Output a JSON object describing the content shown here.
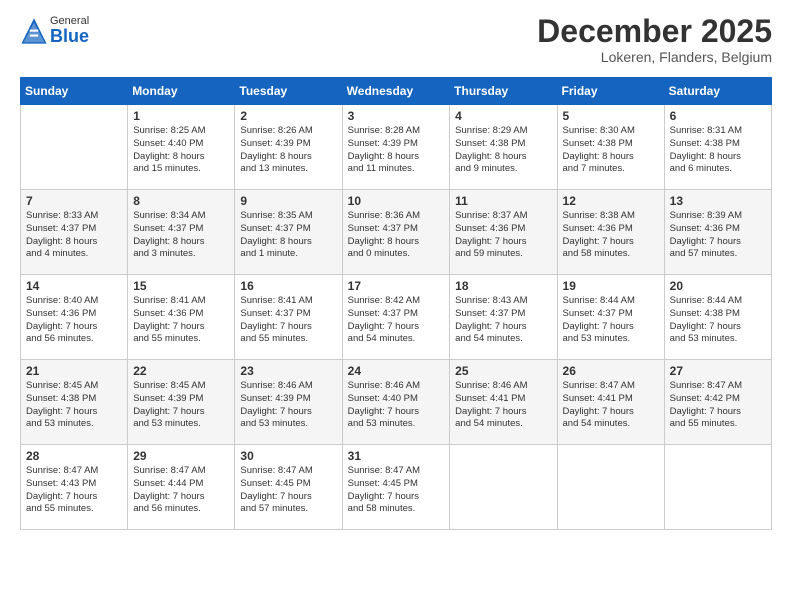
{
  "header": {
    "logo_general": "General",
    "logo_blue": "Blue",
    "month_title": "December 2025",
    "location": "Lokeren, Flanders, Belgium"
  },
  "days_of_week": [
    "Sunday",
    "Monday",
    "Tuesday",
    "Wednesday",
    "Thursday",
    "Friday",
    "Saturday"
  ],
  "weeks": [
    [
      {
        "day": "",
        "info": ""
      },
      {
        "day": "1",
        "info": "Sunrise: 8:25 AM\nSunset: 4:40 PM\nDaylight: 8 hours\nand 15 minutes."
      },
      {
        "day": "2",
        "info": "Sunrise: 8:26 AM\nSunset: 4:39 PM\nDaylight: 8 hours\nand 13 minutes."
      },
      {
        "day": "3",
        "info": "Sunrise: 8:28 AM\nSunset: 4:39 PM\nDaylight: 8 hours\nand 11 minutes."
      },
      {
        "day": "4",
        "info": "Sunrise: 8:29 AM\nSunset: 4:38 PM\nDaylight: 8 hours\nand 9 minutes."
      },
      {
        "day": "5",
        "info": "Sunrise: 8:30 AM\nSunset: 4:38 PM\nDaylight: 8 hours\nand 7 minutes."
      },
      {
        "day": "6",
        "info": "Sunrise: 8:31 AM\nSunset: 4:38 PM\nDaylight: 8 hours\nand 6 minutes."
      }
    ],
    [
      {
        "day": "7",
        "info": "Sunrise: 8:33 AM\nSunset: 4:37 PM\nDaylight: 8 hours\nand 4 minutes."
      },
      {
        "day": "8",
        "info": "Sunrise: 8:34 AM\nSunset: 4:37 PM\nDaylight: 8 hours\nand 3 minutes."
      },
      {
        "day": "9",
        "info": "Sunrise: 8:35 AM\nSunset: 4:37 PM\nDaylight: 8 hours\nand 1 minute."
      },
      {
        "day": "10",
        "info": "Sunrise: 8:36 AM\nSunset: 4:37 PM\nDaylight: 8 hours\nand 0 minutes."
      },
      {
        "day": "11",
        "info": "Sunrise: 8:37 AM\nSunset: 4:36 PM\nDaylight: 7 hours\nand 59 minutes."
      },
      {
        "day": "12",
        "info": "Sunrise: 8:38 AM\nSunset: 4:36 PM\nDaylight: 7 hours\nand 58 minutes."
      },
      {
        "day": "13",
        "info": "Sunrise: 8:39 AM\nSunset: 4:36 PM\nDaylight: 7 hours\nand 57 minutes."
      }
    ],
    [
      {
        "day": "14",
        "info": "Sunrise: 8:40 AM\nSunset: 4:36 PM\nDaylight: 7 hours\nand 56 minutes."
      },
      {
        "day": "15",
        "info": "Sunrise: 8:41 AM\nSunset: 4:36 PM\nDaylight: 7 hours\nand 55 minutes."
      },
      {
        "day": "16",
        "info": "Sunrise: 8:41 AM\nSunset: 4:37 PM\nDaylight: 7 hours\nand 55 minutes."
      },
      {
        "day": "17",
        "info": "Sunrise: 8:42 AM\nSunset: 4:37 PM\nDaylight: 7 hours\nand 54 minutes."
      },
      {
        "day": "18",
        "info": "Sunrise: 8:43 AM\nSunset: 4:37 PM\nDaylight: 7 hours\nand 54 minutes."
      },
      {
        "day": "19",
        "info": "Sunrise: 8:44 AM\nSunset: 4:37 PM\nDaylight: 7 hours\nand 53 minutes."
      },
      {
        "day": "20",
        "info": "Sunrise: 8:44 AM\nSunset: 4:38 PM\nDaylight: 7 hours\nand 53 minutes."
      }
    ],
    [
      {
        "day": "21",
        "info": "Sunrise: 8:45 AM\nSunset: 4:38 PM\nDaylight: 7 hours\nand 53 minutes."
      },
      {
        "day": "22",
        "info": "Sunrise: 8:45 AM\nSunset: 4:39 PM\nDaylight: 7 hours\nand 53 minutes."
      },
      {
        "day": "23",
        "info": "Sunrise: 8:46 AM\nSunset: 4:39 PM\nDaylight: 7 hours\nand 53 minutes."
      },
      {
        "day": "24",
        "info": "Sunrise: 8:46 AM\nSunset: 4:40 PM\nDaylight: 7 hours\nand 53 minutes."
      },
      {
        "day": "25",
        "info": "Sunrise: 8:46 AM\nSunset: 4:41 PM\nDaylight: 7 hours\nand 54 minutes."
      },
      {
        "day": "26",
        "info": "Sunrise: 8:47 AM\nSunset: 4:41 PM\nDaylight: 7 hours\nand 54 minutes."
      },
      {
        "day": "27",
        "info": "Sunrise: 8:47 AM\nSunset: 4:42 PM\nDaylight: 7 hours\nand 55 minutes."
      }
    ],
    [
      {
        "day": "28",
        "info": "Sunrise: 8:47 AM\nSunset: 4:43 PM\nDaylight: 7 hours\nand 55 minutes."
      },
      {
        "day": "29",
        "info": "Sunrise: 8:47 AM\nSunset: 4:44 PM\nDaylight: 7 hours\nand 56 minutes."
      },
      {
        "day": "30",
        "info": "Sunrise: 8:47 AM\nSunset: 4:45 PM\nDaylight: 7 hours\nand 57 minutes."
      },
      {
        "day": "31",
        "info": "Sunrise: 8:47 AM\nSunset: 4:45 PM\nDaylight: 7 hours\nand 58 minutes."
      },
      {
        "day": "",
        "info": ""
      },
      {
        "day": "",
        "info": ""
      },
      {
        "day": "",
        "info": ""
      }
    ]
  ]
}
